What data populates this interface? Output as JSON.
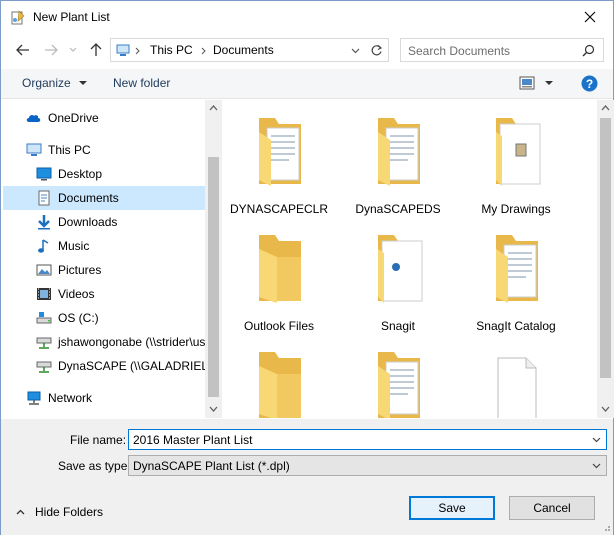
{
  "window": {
    "title": "New Plant List"
  },
  "address": {
    "segments": [
      "This PC",
      "Documents"
    ]
  },
  "search": {
    "placeholder": "Search Documents"
  },
  "toolbar": {
    "organize": "Organize",
    "new_folder": "New folder"
  },
  "nav": {
    "items": [
      {
        "label": "OneDrive",
        "icon": "onedrive-icon"
      },
      {
        "label": "This PC",
        "icon": "this-pc-icon"
      },
      {
        "label": "Desktop",
        "icon": "desktop-icon"
      },
      {
        "label": "Documents",
        "icon": "documents-icon"
      },
      {
        "label": "Downloads",
        "icon": "downloads-icon"
      },
      {
        "label": "Music",
        "icon": "music-icon"
      },
      {
        "label": "Pictures",
        "icon": "pictures-icon"
      },
      {
        "label": "Videos",
        "icon": "videos-icon"
      },
      {
        "label": "OS (C:)",
        "icon": "drive-icon"
      },
      {
        "label": "jshawongonabe (\\\\strider\\us",
        "icon": "network-drive-icon"
      },
      {
        "label": "DynaSCAPE (\\\\GALADRIEL\\\\",
        "icon": "network-drive-icon"
      },
      {
        "label": "Network",
        "icon": "network-icon"
      }
    ]
  },
  "files": [
    {
      "label": "DYNASCAPECLR",
      "kind": "folder-docs"
    },
    {
      "label": "DynaSCAPEDS",
      "kind": "folder-docs"
    },
    {
      "label": "My Drawings",
      "kind": "folder-image"
    },
    {
      "label": "Outlook Files",
      "kind": "folder-plain"
    },
    {
      "label": "Snagit",
      "kind": "folder-snagit"
    },
    {
      "label": "SnagIt Catalog",
      "kind": "folder-docs"
    },
    {
      "label": "",
      "kind": "folder-plain"
    },
    {
      "label": "",
      "kind": "folder-docs"
    },
    {
      "label": "",
      "kind": "file-blank"
    }
  ],
  "form": {
    "file_name_label": "File name:",
    "file_name_value": "2016 Master Plant List",
    "save_type_label": "Save as type:",
    "save_type_value": "DynaSCAPE Plant List (*.dpl)"
  },
  "buttons": {
    "hide_folders": "Hide Folders",
    "save": "Save",
    "cancel": "Cancel"
  },
  "colors": {
    "accent": "#0078d7",
    "folder": "#f8d775",
    "selected": "#cce8ff",
    "help": "#1a73c8"
  }
}
